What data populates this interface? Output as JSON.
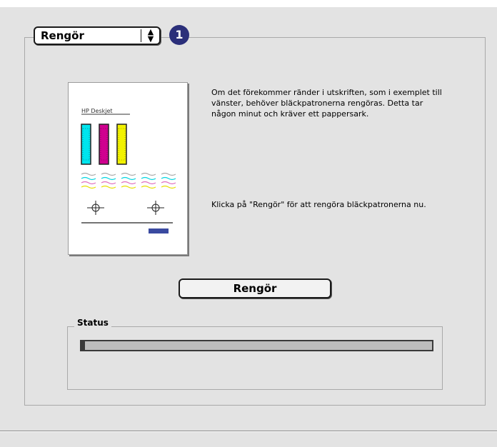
{
  "mode_popup": {
    "selected": "Rengör"
  },
  "callout_badge": "1",
  "preview": {
    "page_title": "HP Deskjet"
  },
  "description": "Om det förekommer ränder i utskriften, som i exemplet till vänster, behöver bläckpatronerna rengöras. Detta tar någon minut och kräver ett pappersark.",
  "instruction": "Klicka på \"Rengör\" för att rengöra bläckpatronerna nu.",
  "clean_button": {
    "label": "Rengör"
  },
  "status": {
    "legend": "Status",
    "progress": 0.01
  },
  "colors": {
    "cyan": "#00e5ee",
    "magenta": "#d0008f",
    "yellow": "#f2f200",
    "badge": "#2b2f7a"
  }
}
